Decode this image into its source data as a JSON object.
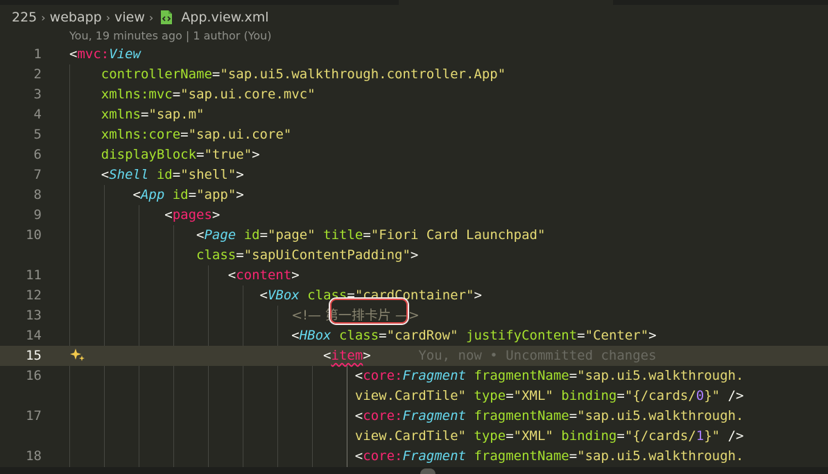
{
  "breadcrumb": {
    "items": [
      "225",
      "webapp",
      "view"
    ],
    "separator": "›",
    "file_icon": "xml-file-icon",
    "file": "App.view.xml"
  },
  "codelens": {
    "text": "You, 19 minutes ago | 1 author (You)"
  },
  "current_line": 15,
  "lines": [
    {
      "n": "1",
      "tokens": [
        [
          "pun",
          "<"
        ],
        [
          "tag",
          "mvc"
        ],
        [
          "tag",
          ":"
        ],
        [
          "cls",
          "View"
        ]
      ]
    },
    {
      "n": "2",
      "tokens": [
        [
          "pun",
          "    "
        ],
        [
          "attr",
          "controllerName"
        ],
        [
          "pun",
          "="
        ],
        [
          "str",
          "\"sap.ui5.walkthrough.controller.App\""
        ]
      ]
    },
    {
      "n": "3",
      "tokens": [
        [
          "pun",
          "    "
        ],
        [
          "attr",
          "xmlns:mvc"
        ],
        [
          "pun",
          "="
        ],
        [
          "str",
          "\"sap.ui.core.mvc\""
        ]
      ]
    },
    {
      "n": "4",
      "tokens": [
        [
          "pun",
          "    "
        ],
        [
          "attr",
          "xmlns"
        ],
        [
          "pun",
          "="
        ],
        [
          "str",
          "\"sap.m\""
        ]
      ]
    },
    {
      "n": "5",
      "tokens": [
        [
          "pun",
          "    "
        ],
        [
          "attr",
          "xmlns:core"
        ],
        [
          "pun",
          "="
        ],
        [
          "str",
          "\"sap.ui.core\""
        ]
      ]
    },
    {
      "n": "6",
      "tokens": [
        [
          "pun",
          "    "
        ],
        [
          "attr",
          "displayBlock"
        ],
        [
          "pun",
          "="
        ],
        [
          "str",
          "\"true\""
        ],
        [
          "pun",
          ">"
        ]
      ]
    },
    {
      "n": "7",
      "tokens": [
        [
          "pun",
          "    <"
        ],
        [
          "cls",
          "Shell"
        ],
        [
          "pun",
          " "
        ],
        [
          "attr",
          "id"
        ],
        [
          "pun",
          "="
        ],
        [
          "str",
          "\"shell\""
        ],
        [
          "pun",
          ">"
        ]
      ]
    },
    {
      "n": "8",
      "tokens": [
        [
          "pun",
          "        <"
        ],
        [
          "cls",
          "App"
        ],
        [
          "pun",
          " "
        ],
        [
          "attr",
          "id"
        ],
        [
          "pun",
          "="
        ],
        [
          "str",
          "\"app\""
        ],
        [
          "pun",
          ">"
        ]
      ]
    },
    {
      "n": "9",
      "tokens": [
        [
          "pun",
          "            <"
        ],
        [
          "tag",
          "pages"
        ],
        [
          "pun",
          ">"
        ]
      ]
    },
    {
      "n": "10",
      "tokens": [
        [
          "pun",
          "                <"
        ],
        [
          "cls",
          "Page"
        ],
        [
          "pun",
          " "
        ],
        [
          "attr",
          "id"
        ],
        [
          "pun",
          "="
        ],
        [
          "str",
          "\"page\""
        ],
        [
          "pun",
          " "
        ],
        [
          "attr",
          "title"
        ],
        [
          "pun",
          "="
        ],
        [
          "str",
          "\"Fiori Card Launchpad\""
        ]
      ]
    },
    {
      "n": "",
      "tokens": [
        [
          "pun",
          "                "
        ],
        [
          "attr",
          "class"
        ],
        [
          "pun",
          "="
        ],
        [
          "str",
          "\"sapUiContentPadding\""
        ],
        [
          "pun",
          ">"
        ]
      ]
    },
    {
      "n": "11",
      "tokens": [
        [
          "pun",
          "                    <"
        ],
        [
          "tag",
          "content"
        ],
        [
          "pun",
          ">"
        ]
      ]
    },
    {
      "n": "12",
      "tokens": [
        [
          "pun",
          "                        <"
        ],
        [
          "cls",
          "VBox"
        ],
        [
          "pun",
          " "
        ],
        [
          "attr",
          "class"
        ],
        [
          "pun",
          "="
        ],
        [
          "str",
          "\"cardContainer\""
        ],
        [
          "pun",
          ">"
        ]
      ]
    },
    {
      "n": "13",
      "tokens": [
        [
          "pun",
          "                            "
        ],
        [
          "comment",
          "<!— 第一排卡片 —>"
        ]
      ]
    },
    {
      "n": "14",
      "tokens": [
        [
          "pun",
          "                            <"
        ],
        [
          "cls",
          "HBox"
        ],
        [
          "pun",
          " "
        ],
        [
          "attr",
          "class"
        ],
        [
          "pun",
          "="
        ],
        [
          "str",
          "\"cardRow\""
        ],
        [
          "pun",
          " "
        ],
        [
          "attr",
          "justifyContent"
        ],
        [
          "pun",
          "="
        ],
        [
          "str",
          "\"Center\""
        ],
        [
          "pun",
          ">"
        ]
      ]
    },
    {
      "n": "15",
      "tokens": [
        [
          "pun",
          "                                <"
        ],
        [
          "tag",
          "item"
        ],
        [
          "pun",
          ">"
        ],
        [
          "pun",
          "      "
        ],
        [
          "blame",
          "You, now • Uncommitted changes"
        ]
      ]
    },
    {
      "n": "16",
      "tokens": [
        [
          "pun",
          "                                    <"
        ],
        [
          "tag",
          "core"
        ],
        [
          "tag",
          ":"
        ],
        [
          "cls",
          "Fragment"
        ],
        [
          "pun",
          " "
        ],
        [
          "attr",
          "fragmentName"
        ],
        [
          "pun",
          "="
        ],
        [
          "str",
          "\"sap.ui5.walkthrough."
        ]
      ]
    },
    {
      "n": "",
      "tokens": [
        [
          "pun",
          "                                    "
        ],
        [
          "str",
          "view.CardTile\""
        ],
        [
          "pun",
          " "
        ],
        [
          "attr",
          "type"
        ],
        [
          "pun",
          "="
        ],
        [
          "str",
          "\"XML\""
        ],
        [
          "pun",
          " "
        ],
        [
          "attr",
          "binding"
        ],
        [
          "pun",
          "="
        ],
        [
          "str",
          "\"{/cards/"
        ],
        [
          "num",
          "0"
        ],
        [
          "str",
          "}\""
        ],
        [
          "pun",
          " />"
        ]
      ]
    },
    {
      "n": "17",
      "tokens": [
        [
          "pun",
          "                                    <"
        ],
        [
          "tag",
          "core"
        ],
        [
          "tag",
          ":"
        ],
        [
          "cls",
          "Fragment"
        ],
        [
          "pun",
          " "
        ],
        [
          "attr",
          "fragmentName"
        ],
        [
          "pun",
          "="
        ],
        [
          "str",
          "\"sap.ui5.walkthrough."
        ]
      ]
    },
    {
      "n": "",
      "tokens": [
        [
          "pun",
          "                                    "
        ],
        [
          "str",
          "view.CardTile\""
        ],
        [
          "pun",
          " "
        ],
        [
          "attr",
          "type"
        ],
        [
          "pun",
          "="
        ],
        [
          "str",
          "\"XML\""
        ],
        [
          "pun",
          " "
        ],
        [
          "attr",
          "binding"
        ],
        [
          "pun",
          "="
        ],
        [
          "str",
          "\"{/cards/"
        ],
        [
          "num",
          "1"
        ],
        [
          "str",
          "}\""
        ],
        [
          "pun",
          " />"
        ]
      ]
    },
    {
      "n": "18",
      "tokens": [
        [
          "pun",
          "                                    <"
        ],
        [
          "tag",
          "core"
        ],
        [
          "tag",
          ":"
        ],
        [
          "cls",
          "Fragment"
        ],
        [
          "pun",
          " "
        ],
        [
          "attr",
          "fragmentName"
        ],
        [
          "pun",
          "="
        ],
        [
          "str",
          "\"sap.ui5.walkthrough."
        ]
      ]
    }
  ]
}
